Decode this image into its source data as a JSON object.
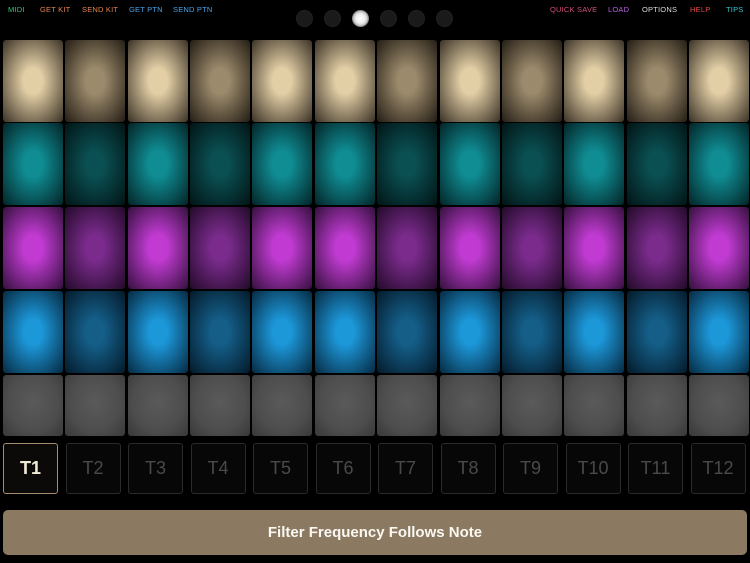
{
  "toolbar": {
    "left": [
      {
        "id": "midi",
        "label": "MIDI",
        "color": "#2ecc71"
      },
      {
        "id": "get-kit",
        "label": "GET KIT",
        "color": "#e8834e"
      },
      {
        "id": "send-kit",
        "label": "SEND KIT",
        "color": "#e8834e"
      },
      {
        "id": "get-ptn",
        "label": "GET PTN",
        "color": "#4aa3e8"
      },
      {
        "id": "send-ptn",
        "label": "SEND PTN",
        "color": "#4aa3e8"
      }
    ],
    "right": [
      {
        "id": "quick-save",
        "label": "QUICK SAVE",
        "color": "#d04f7a"
      },
      {
        "id": "load",
        "label": "LOAD",
        "color": "#b463e0"
      },
      {
        "id": "options",
        "label": "OPTIONS",
        "color": "#d9d9d9"
      },
      {
        "id": "help",
        "label": "HELP",
        "color": "#e24b4b"
      },
      {
        "id": "tips",
        "label": "TIPS",
        "color": "#33c6cf"
      }
    ]
  },
  "pages": {
    "count": 6,
    "active": 2
  },
  "pad_rows": [
    {
      "name": "tan",
      "bright": "#e3cfa6",
      "dim": "#9c8a6c",
      "edge": "#3b3226",
      "edge_dim": "#231d14"
    },
    {
      "name": "teal",
      "bright": "#0f8d93",
      "dim": "#0a4f52",
      "edge": "#032427",
      "edge_dim": "#021415"
    },
    {
      "name": "purple",
      "bright": "#c13bd2",
      "dim": "#7a2b8c",
      "edge": "#35103e",
      "edge_dim": "#230a29"
    },
    {
      "name": "blue",
      "bright": "#1c97d8",
      "dim": "#145e88",
      "edge": "#062a42",
      "edge_dim": "#041a2a"
    },
    {
      "name": "gray",
      "bright": "#565656",
      "dim": "#565656",
      "edge": "#303030",
      "edge_dim": "#303030"
    }
  ],
  "pad_pattern": [
    1,
    0,
    1,
    0,
    1,
    1,
    0,
    1,
    0,
    1,
    0,
    1
  ],
  "tracks": [
    "T1",
    "T2",
    "T3",
    "T4",
    "T5",
    "T6",
    "T7",
    "T8",
    "T9",
    "T10",
    "T11",
    "T12"
  ],
  "active_track": 0,
  "param_button": {
    "label": "Filter Frequency Follows Note"
  }
}
